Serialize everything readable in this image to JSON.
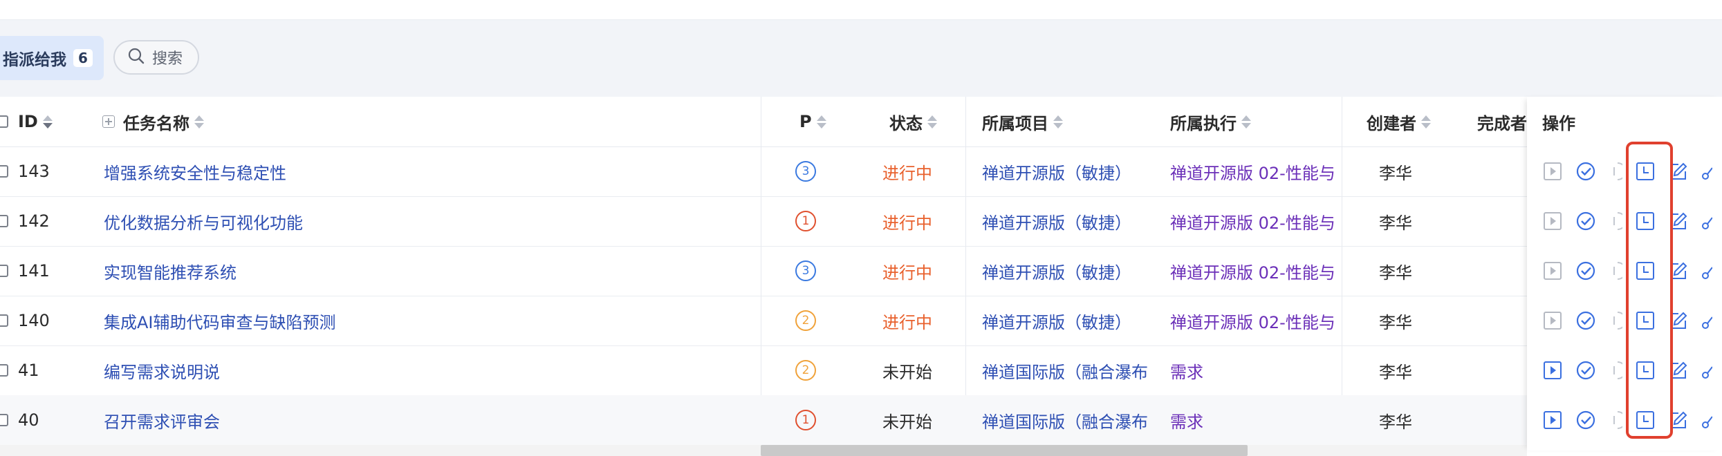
{
  "filter": {
    "assigned_label": "指派给我",
    "assigned_count": "6",
    "search_label": "搜索"
  },
  "columns": {
    "id": "ID",
    "name": "任务名称",
    "pri": "P",
    "status": "状态",
    "project": "所属项目",
    "execution": "所属执行",
    "creator": "创建者",
    "finisher": "完成者",
    "actions": "操作"
  },
  "rows": [
    {
      "id": "143",
      "name": "增强系统安全性与稳定性",
      "pri": "3",
      "pri_color": "#3a79e0",
      "status": "进行中",
      "status_kind": "doing",
      "project": "禅道开源版（敏捷）",
      "execution": "禅道开源版 02-性能与",
      "creator": "李华",
      "start_enabled": false
    },
    {
      "id": "142",
      "name": "优化数据分析与可视化功能",
      "pri": "1",
      "pri_color": "#e0502e",
      "status": "进行中",
      "status_kind": "doing",
      "project": "禅道开源版（敏捷）",
      "execution": "禅道开源版 02-性能与",
      "creator": "李华",
      "start_enabled": false
    },
    {
      "id": "141",
      "name": "实现智能推荐系统",
      "pri": "3",
      "pri_color": "#3a79e0",
      "status": "进行中",
      "status_kind": "doing",
      "project": "禅道开源版（敏捷）",
      "execution": "禅道开源版 02-性能与",
      "creator": "李华",
      "start_enabled": false
    },
    {
      "id": "140",
      "name": "集成AI辅助代码审查与缺陷预测",
      "pri": "2",
      "pri_color": "#f0a23a",
      "status": "进行中",
      "status_kind": "doing",
      "project": "禅道开源版（敏捷）",
      "execution": "禅道开源版 02-性能与",
      "creator": "李华",
      "start_enabled": false
    },
    {
      "id": "41",
      "name": "编写需求说明说",
      "pri": "2",
      "pri_color": "#f0a23a",
      "status": "未开始",
      "status_kind": "wait",
      "project": "禅道国际版（融合瀑布",
      "execution": "需求",
      "creator": "李华",
      "start_enabled": true
    },
    {
      "id": "40",
      "name": "召开需求评审会",
      "pri": "1",
      "pri_color": "#e0502e",
      "status": "未开始",
      "status_kind": "wait",
      "project": "禅道国际版（融合瀑布",
      "execution": "需求",
      "creator": "李华",
      "start_enabled": true
    }
  ],
  "colors": {
    "link": "#2e4fb3",
    "execution_link": "#6b2fb8",
    "status_doing": "#e8602c",
    "action_blue": "#3a6fe0",
    "highlight": "#e0402e"
  },
  "icons": [
    "search-icon",
    "start-icon",
    "finish-icon",
    "pause-icon",
    "record-hours-icon",
    "edit-icon",
    "link-icon"
  ]
}
